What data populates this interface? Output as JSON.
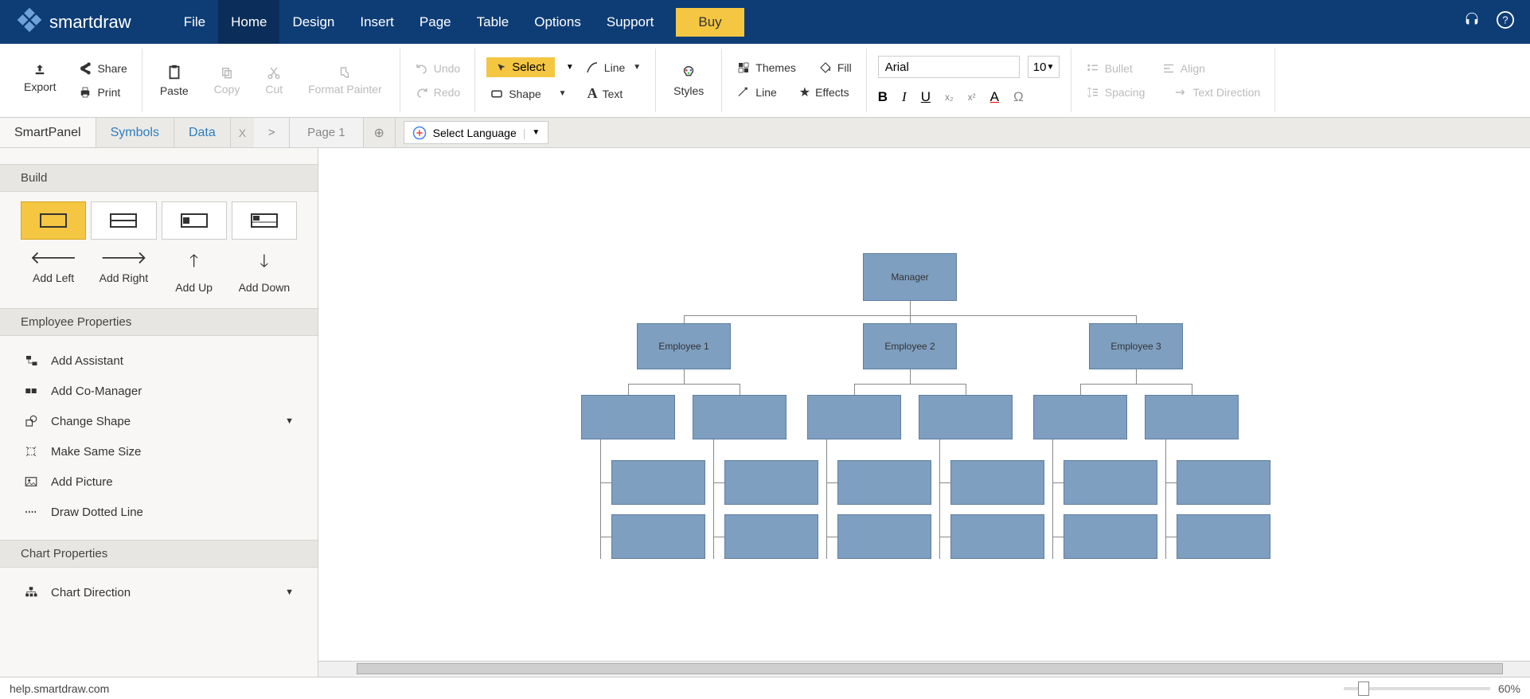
{
  "logo_text": "smartdraw",
  "topnav": {
    "file": "File",
    "home": "Home",
    "design": "Design",
    "insert": "Insert",
    "page": "Page",
    "table": "Table",
    "options": "Options",
    "support": "Support",
    "buy": "Buy"
  },
  "ribbon": {
    "export": "Export",
    "share": "Share",
    "print": "Print",
    "paste": "Paste",
    "copy": "Copy",
    "cut": "Cut",
    "format_painter": "Format Painter",
    "undo": "Undo",
    "redo": "Redo",
    "select": "Select",
    "line": "Line",
    "shape": "Shape",
    "text": "Text",
    "styles": "Styles",
    "themes": "Themes",
    "fill": "Fill",
    "line2": "Line",
    "effects": "Effects",
    "font": "Arial",
    "size": "10",
    "bullet": "Bullet",
    "align": "Align",
    "spacing": "Spacing",
    "direction": "Text Direction"
  },
  "paneltabs": {
    "smartpanel": "SmartPanel",
    "symbols": "Symbols",
    "data": "Data",
    "page1": "Page 1"
  },
  "lang": "Select Language",
  "side": {
    "build": "Build",
    "addleft": "Add Left",
    "addright": "Add Right",
    "addup": "Add Up",
    "adddown": "Add Down",
    "emp_props": "Employee Properties",
    "add_assistant": "Add Assistant",
    "add_comgr": "Add Co-Manager",
    "change_shape": "Change Shape",
    "same_size": "Make Same Size",
    "add_picture": "Add Picture",
    "dotted": "Draw Dotted Line",
    "chart_props": "Chart Properties",
    "chart_dir": "Chart Direction"
  },
  "chart": {
    "manager": "Manager",
    "e1": "Employee 1",
    "e2": "Employee 2",
    "e3": "Employee 3"
  },
  "status": {
    "url": "help.smartdraw.com",
    "zoom": "60%"
  }
}
